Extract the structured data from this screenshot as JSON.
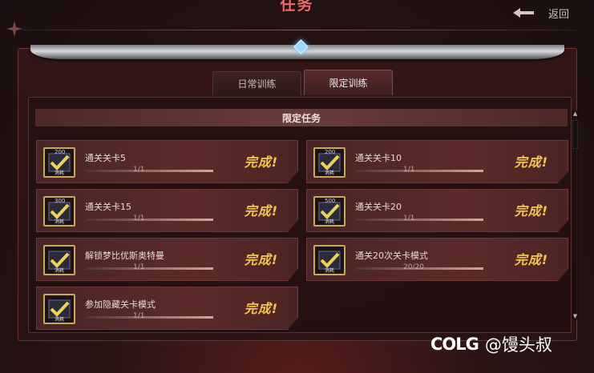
{
  "header": {
    "title": "任务",
    "back_label": "返回"
  },
  "tabs": [
    {
      "label": "日常训练",
      "active": false
    },
    {
      "label": "限定训练",
      "active": true
    }
  ],
  "section_title": "限定任务",
  "tasks": [
    {
      "name": "通关关卡5",
      "progress": "1/1",
      "fraction": 1,
      "status": "完成!",
      "badge_num": "200",
      "badge_sub": "消耗"
    },
    {
      "name": "通关关卡10",
      "progress": "1/1",
      "fraction": 1,
      "status": "完成!",
      "badge_num": "200",
      "badge_sub": "消耗"
    },
    {
      "name": "通关关卡15",
      "progress": "1/1",
      "fraction": 1,
      "status": "完成!",
      "badge_num": "300",
      "badge_sub": "消耗"
    },
    {
      "name": "通关关卡20",
      "progress": "1/1",
      "fraction": 1,
      "status": "完成!",
      "badge_num": "500",
      "badge_sub": "消耗"
    },
    {
      "name": "解锁梦比优斯奥特曼",
      "progress": "1/1",
      "fraction": 1,
      "status": "完成!",
      "badge_num": "",
      "badge_sub": "消耗"
    },
    {
      "name": "通关20次关卡模式",
      "progress": "20/20",
      "fraction": 1,
      "status": "完成!",
      "badge_num": "",
      "badge_sub": "消耗"
    },
    {
      "name": "参加隐藏关卡模式",
      "progress": "1/1",
      "fraction": 1,
      "status": "完成!",
      "badge_num": "",
      "badge_sub": "消耗"
    }
  ],
  "watermark": {
    "logo": "COLG",
    "user": "@馒头叔"
  },
  "colors": {
    "accent_title": "#f06a68",
    "complete_text": "#f2c64e",
    "badge_border": "#c9a955",
    "check": "#e9d35a"
  },
  "icons": {
    "back": "arrow-left-icon",
    "badge": "checkmark-icon",
    "gem": "diamond-icon",
    "star": "sparkle-icon"
  }
}
